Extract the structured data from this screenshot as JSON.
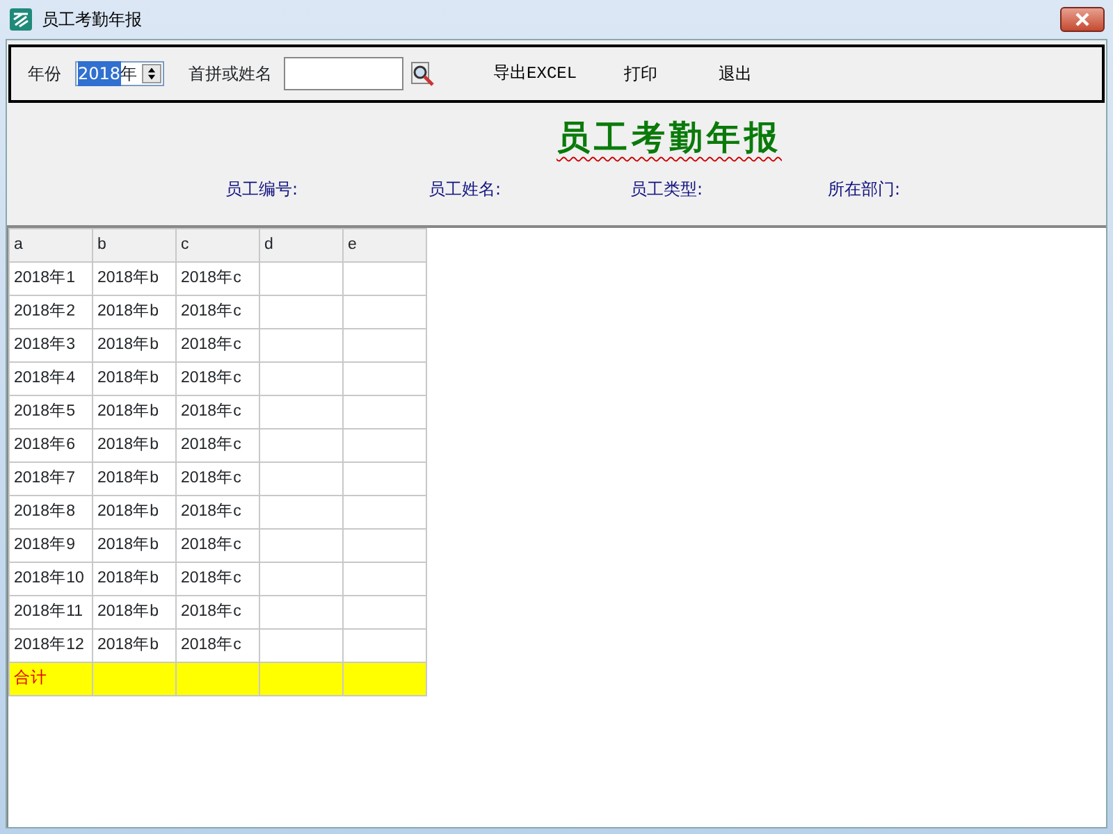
{
  "window": {
    "title": "员工考勤年报"
  },
  "toolbar": {
    "year_label": "年份",
    "year_value": "2018",
    "year_suffix": "年",
    "search_label": "首拼或姓名",
    "buttons": [
      "导出EXCEL",
      "打印",
      "退出"
    ]
  },
  "report": {
    "title": "员工考勤年报",
    "fields": [
      "员工编号:",
      "员工姓名:",
      "员工类型:",
      "所在部门:"
    ]
  },
  "table": {
    "columns": [
      "a",
      "b",
      "c",
      "d",
      "e"
    ],
    "rows": [
      {
        "kind": "data",
        "cells": [
          "2018年1",
          "2018年b",
          "2018年c",
          "",
          ""
        ]
      },
      {
        "kind": "data",
        "cells": [
          "2018年2",
          "2018年b",
          "2018年c",
          "",
          ""
        ]
      },
      {
        "kind": "data",
        "cells": [
          "2018年3",
          "2018年b",
          "2018年c",
          "",
          ""
        ]
      },
      {
        "kind": "data",
        "cells": [
          "2018年4",
          "2018年b",
          "2018年c",
          "",
          ""
        ]
      },
      {
        "kind": "data",
        "cells": [
          "2018年5",
          "2018年b",
          "2018年c",
          "",
          ""
        ]
      },
      {
        "kind": "data",
        "cells": [
          "2018年6",
          "2018年b",
          "2018年c",
          "",
          ""
        ]
      },
      {
        "kind": "data",
        "cells": [
          "2018年7",
          "2018年b",
          "2018年c",
          "",
          ""
        ]
      },
      {
        "kind": "data",
        "cells": [
          "2018年8",
          "2018年b",
          "2018年c",
          "",
          ""
        ]
      },
      {
        "kind": "data",
        "cells": [
          "2018年9",
          "2018年b",
          "2018年c",
          "",
          ""
        ]
      },
      {
        "kind": "data",
        "cells": [
          "2018年10",
          "2018年b",
          "2018年c",
          "",
          ""
        ]
      },
      {
        "kind": "data",
        "cells": [
          "2018年11",
          "2018年b",
          "2018年c",
          "",
          ""
        ]
      },
      {
        "kind": "data",
        "cells": [
          "2018年12",
          "2018年b",
          "2018年c",
          "",
          ""
        ]
      },
      {
        "kind": "total",
        "cells": [
          "合计",
          "",
          "",
          "",
          ""
        ]
      }
    ]
  }
}
